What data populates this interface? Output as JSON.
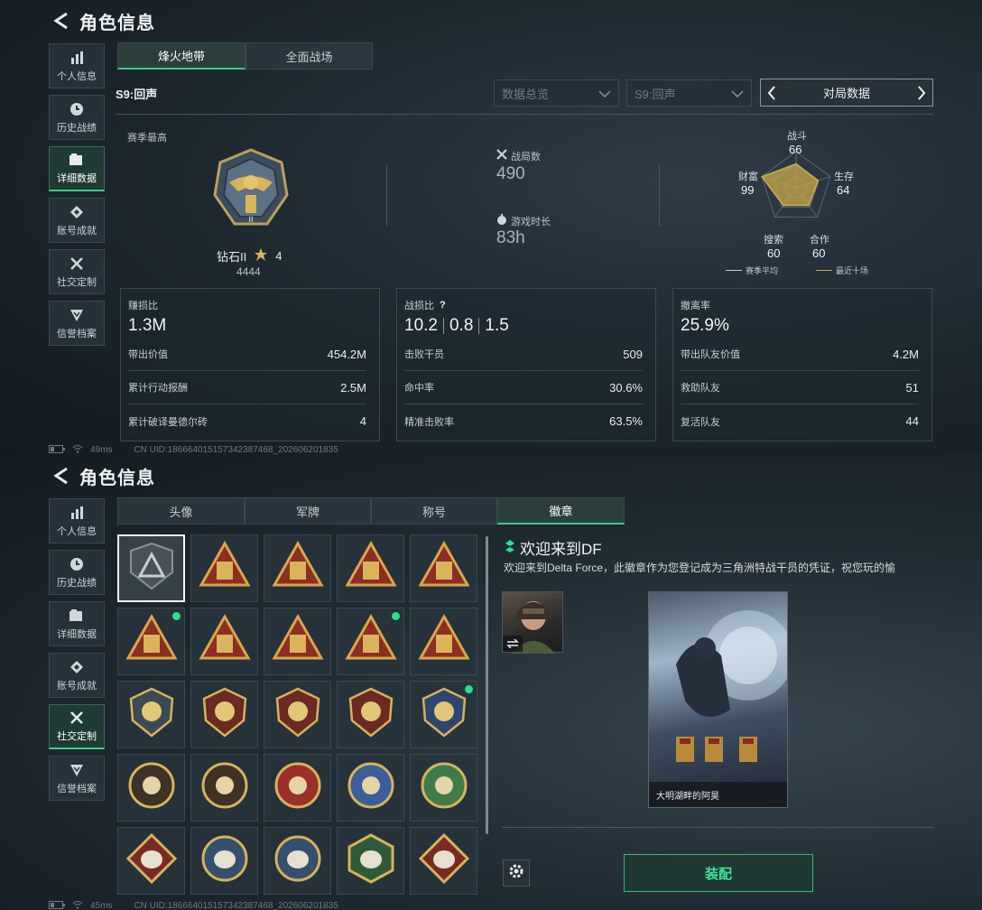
{
  "screen1": {
    "title": "角色信息",
    "nav": [
      {
        "label": "个人信息",
        "icon": "bar-chart-icon"
      },
      {
        "label": "历史战绩",
        "icon": "clock-icon"
      },
      {
        "label": "详细数据",
        "icon": "folder-icon",
        "active": true
      },
      {
        "label": "账号成就",
        "icon": "achievement-icon"
      },
      {
        "label": "社交定制",
        "icon": "tools-icon"
      },
      {
        "label": "信誉档案",
        "icon": "shield-rank-icon"
      }
    ],
    "tabs": [
      {
        "label": "烽火地带",
        "active": true
      },
      {
        "label": "全面战场"
      }
    ],
    "season": "S9:回声",
    "dropdown1": "数据总览",
    "dropdown2": "S9:回声",
    "pager_label": "对局数据",
    "season_best_label": "赛季最高",
    "rank_name": "钻石II",
    "rank_stars": "4",
    "rank_score": "4444",
    "matches_label": "战局数",
    "matches_value": "490",
    "playtime_label": "游戏时长",
    "playtime_value": "83h",
    "radar": {
      "combat_label": "战斗",
      "combat_value": "66",
      "survival_label": "生存",
      "survival_value": "64",
      "teamwork_label": "合作",
      "teamwork_value": "60",
      "search_label": "搜索",
      "search_value": "60",
      "wealth_label": "财富",
      "wealth_value": "99",
      "legend_avg": "赛季平均",
      "legend_recent": "最近十场",
      "avg_color": "#c9d2d8",
      "recent_color": "#c8a84a"
    },
    "cards": [
      {
        "title": "赚损比",
        "main": "1.3M",
        "rows": [
          {
            "label": "带出价值",
            "value": "454.2M"
          },
          {
            "label": "累计行动报酬",
            "value": "2.5M"
          },
          {
            "label": "累计破译曼德尔砖",
            "value": "4"
          }
        ]
      },
      {
        "title": "战损比",
        "main_parts": [
          "10.2",
          "0.8",
          "1.5"
        ],
        "help": "?",
        "rows": [
          {
            "label": "击败干员",
            "value": "509"
          },
          {
            "label": "命中率",
            "value": "30.6%"
          },
          {
            "label": "精准击败率",
            "value": "63.5%"
          }
        ]
      },
      {
        "title": "撤离率",
        "main": "25.9%",
        "rows": [
          {
            "label": "带出队友价值",
            "value": "4.2M"
          },
          {
            "label": "救助队友",
            "value": "51"
          },
          {
            "label": "复活队友",
            "value": "44"
          }
        ]
      }
    ],
    "ping": "49ms",
    "uid": "CN UID:1866640151573423874​68_202606201835"
  },
  "screen2": {
    "title": "角色信息",
    "nav": [
      {
        "label": "个人信息",
        "icon": "bar-chart-icon"
      },
      {
        "label": "历史战绩",
        "icon": "clock-icon"
      },
      {
        "label": "详细数据",
        "icon": "folder-icon"
      },
      {
        "label": "账号成就",
        "icon": "achievement-icon"
      },
      {
        "label": "社交定制",
        "icon": "tools-icon",
        "active": true
      },
      {
        "label": "信誉档案",
        "icon": "shield-rank-icon"
      }
    ],
    "tabs": [
      {
        "label": "头像"
      },
      {
        "label": "军牌"
      },
      {
        "label": "称号"
      },
      {
        "label": "徽章",
        "active": true
      }
    ],
    "badge_icons": [
      "delta-triangle-badge-icon",
      "helicopter-badge-icon",
      "s4-triangle-badge-icon",
      "s5-triangle-badge-icon",
      "s6-triangle-badge-icon",
      "hourglass-triangle-badge-icon",
      "ship-triangle-badge-icon",
      "number-one-triangle-badge-icon",
      "tower-triangle-badge-icon",
      "soldier-triangle-badge-icon",
      "rose-diamond-badge-icon",
      "star-medal-badge-icon",
      "chevron-shield-badge-icon",
      "wing-shield-badge-icon",
      "gem-shield-badge-icon",
      "skull-circle-badge-icon",
      "mask-circle-badge-icon",
      "rifle-blue-shield-badge-icon",
      "rifle-green-shield-badge-icon",
      "rifle-gold-shield-badge-icon",
      "wolf-diamond-badge-icon",
      "eagle-circle-badge-icon",
      "eagle-circle-alt-badge-icon",
      "mantis-hexagon-badge-icon",
      "dragon-diamond-badge-icon"
    ],
    "badge_new_flags": [
      false,
      false,
      false,
      false,
      false,
      true,
      false,
      false,
      true,
      false,
      false,
      false,
      false,
      false,
      true,
      false,
      false,
      false,
      false,
      false,
      false,
      false,
      false,
      false,
      false
    ],
    "detail_title": "欢迎来到DF",
    "detail_desc": "欢迎来到Delta Force，此徽章作为您登记成为三角洲特战干员的凭证，祝您玩的愉",
    "card_caption": "大明湖畔的阿昊",
    "equip_label": "装配",
    "ping": "45ms",
    "uid": "CN UID:1866640151573423874​68_202606201835",
    "accent_color": "#3de59a"
  }
}
